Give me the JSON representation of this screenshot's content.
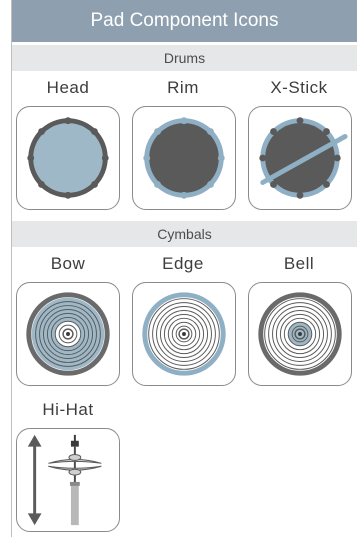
{
  "title": "Pad Component Icons",
  "sections": {
    "drums": {
      "header": "Drums",
      "items": [
        {
          "label": "Head",
          "icon": "drum-head-icon"
        },
        {
          "label": "Rim",
          "icon": "drum-rim-icon"
        },
        {
          "label": "X-Stick",
          "icon": "drum-cross-stick-icon"
        }
      ]
    },
    "cymbals": {
      "header": "Cymbals",
      "items": [
        {
          "label": "Bow",
          "icon": "cymbal-bow-icon"
        },
        {
          "label": "Edge",
          "icon": "cymbal-edge-icon"
        },
        {
          "label": "Bell",
          "icon": "cymbal-bell-icon"
        }
      ]
    },
    "hihat": {
      "items": [
        {
          "label": "Hi-Hat",
          "icon": "hi-hat-icon"
        }
      ]
    }
  },
  "colors": {
    "title_bar": "#8ea0af",
    "section_header": "#e6e7e8",
    "highlight_blue": "#9fb8c8",
    "drum_dark": "#5a5a5a",
    "rim_blue": "#8fb0c4"
  }
}
